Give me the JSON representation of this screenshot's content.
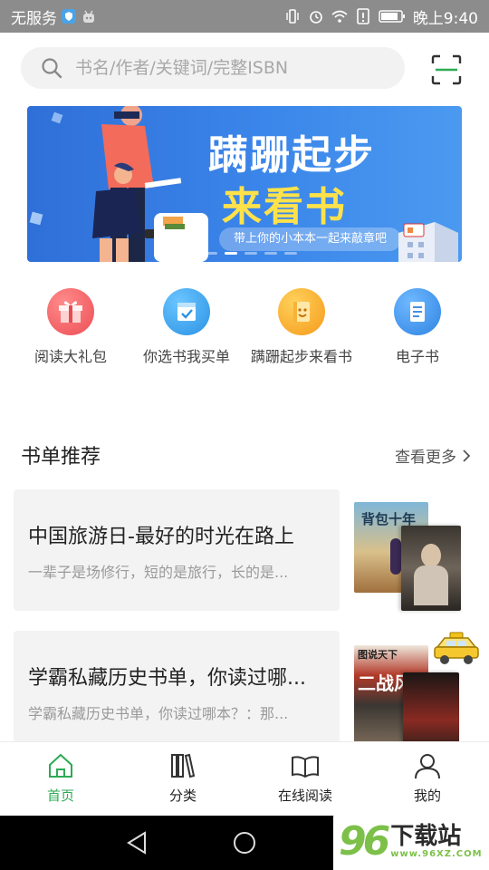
{
  "status_bar": {
    "carrier": "无服务",
    "time": "晚上9:40"
  },
  "search": {
    "placeholder": "书名/作者/关键词/完整ISBN"
  },
  "banner": {
    "title_line1": "蹒跚起步",
    "title_line2": "来看书",
    "tagline": "带上你的小本本一起来敲章吧"
  },
  "quick_entries": [
    {
      "label": "阅读大礼包",
      "icon": "gift-icon",
      "color": "#f25f62"
    },
    {
      "label": "你选书我买单",
      "icon": "book-check-icon",
      "color": "#2f9ee8"
    },
    {
      "label": "蹒跚起步来看书",
      "icon": "smiley-book-icon",
      "color": "#f8a623"
    },
    {
      "label": "电子书",
      "icon": "ebook-icon",
      "color": "#3a8fe6"
    }
  ],
  "section": {
    "title": "书单推荐",
    "more": "查看更多"
  },
  "cards": [
    {
      "title": "中国旅游日-最好的时光在路上",
      "subtitle": "一辈子是场修行，短的是旅行，长的是..."
    },
    {
      "title": "学霸私藏历史书单，你读过哪...",
      "subtitle": "学霸私藏历史书单，你读过哪本？：那..."
    }
  ],
  "covers": {
    "card1_back_title": "背包十年",
    "card2_back_title": "图说天下",
    "card2_back_sub": "二战风"
  },
  "tabs": [
    {
      "label": "首页",
      "icon": "home-icon"
    },
    {
      "label": "分类",
      "icon": "books-icon"
    },
    {
      "label": "在线阅读",
      "icon": "open-book-icon"
    },
    {
      "label": "我的",
      "icon": "user-icon"
    }
  ],
  "watermark": {
    "number": "96",
    "text": "下载站",
    "url": "www.96XZ.COM"
  },
  "colors": {
    "accent_green": "#2eaa55",
    "banner_blue": "#3b86ea",
    "banner_yellow": "#ffe24a"
  }
}
